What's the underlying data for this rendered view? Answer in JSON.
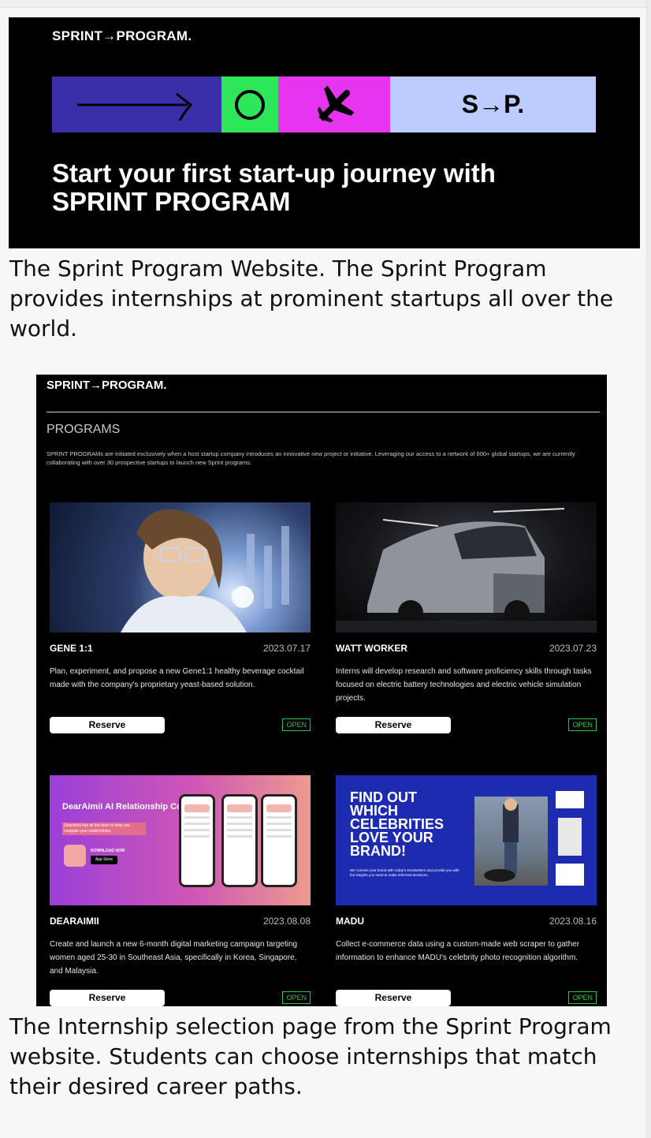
{
  "banner": {
    "logo": "SPRINT→PROGRAM.",
    "badge": "S→P.",
    "headline": "Start your first start-up journey with SPRINT PROGRAM",
    "icons": [
      "arrow-right-icon",
      "circle-icon",
      "airplane-icon"
    ],
    "colors": {
      "blue": "#3a2fa8",
      "green": "#2ee65a",
      "magenta": "#e634f0",
      "lavender": "#bcccff"
    }
  },
  "caption1": "The Sprint Program Website. The Sprint Program provides internships at prominent startups all over the world.",
  "caption2": "The Internship selection page from the Sprint Program website. Students can choose internships that match their desired career paths.",
  "screenshot": {
    "logo": "SPRINT→PROGRAM.",
    "title": "PROGRAMS",
    "description": "SPRINT PROGRAMs are initiated exclusively when a host startup company introduces an innovative new project or initiative. Leveraging our access to a network of 600+ global startups, we are currently collaborating with over 30 prospective startups to launch new Sprint programs.",
    "programs": [
      {
        "name": "GENE 1:1",
        "date": "2023.07.17",
        "description": "Plan, experiment, and propose a new Gene1:1 healthy beverage cocktail made with the company's proprietary yeast-based solution.",
        "button": "Reserve",
        "status": "OPEN"
      },
      {
        "name": "WATT WORKER",
        "date": "2023.07.23",
        "description": "Interns will develop research and software proficiency skills through tasks focused on electric battery technologies and electric vehicle simulation projects.",
        "button": "Reserve",
        "status": "OPEN"
      },
      {
        "name": "DEARAIMII",
        "date": "2023.08.08",
        "description": "Create and launch a new 6-month digital marketing campaign targeting women aged 25-30 in Southeast Asia, specifically in Korea, Singapore, and Malaysia.",
        "button": "Reserve",
        "status": "OPEN",
        "image": {
          "title": "DearAimii AI Relationship Coach",
          "strip": "DearAimii has all the tools to help you navigate your relationships",
          "download": "DOWNLOAD NOW",
          "store": "App Store"
        }
      },
      {
        "name": "MADU",
        "date": "2023.08.16",
        "description": "Collect e-commerce data using a custom-made web scraper to gather information to enhance MADU's celebrity photo recognition algorithm.",
        "button": "Reserve",
        "status": "OPEN",
        "image": {
          "headline": "FIND OUT WHICH CELEBRITIES LOVE YOUR BRAND!",
          "small": "We connect your brand with today's trendsetters and provide you with the insights you need to make informed decisions."
        }
      }
    ]
  }
}
